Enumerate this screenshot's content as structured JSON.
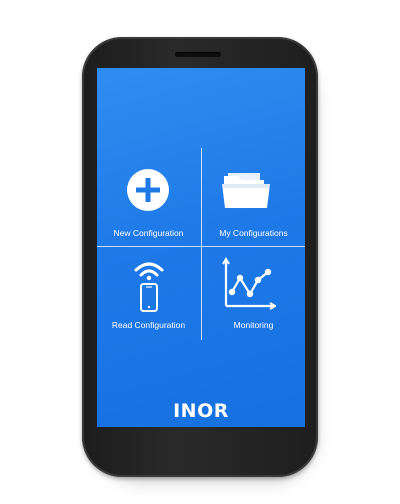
{
  "screen": {
    "background_color": "#1f7ae8",
    "tiles": [
      {
        "label": "New Configuration",
        "icon": "plus-circle-icon"
      },
      {
        "label": "My Configurations",
        "icon": "folder-icon"
      },
      {
        "label": "Read Configuration",
        "icon": "phone-wireless-icon"
      },
      {
        "label": "Monitoring",
        "icon": "line-chart-icon"
      }
    ],
    "brand_logo": "INOR"
  },
  "device": {
    "frame_color": "#1e1e1e"
  }
}
